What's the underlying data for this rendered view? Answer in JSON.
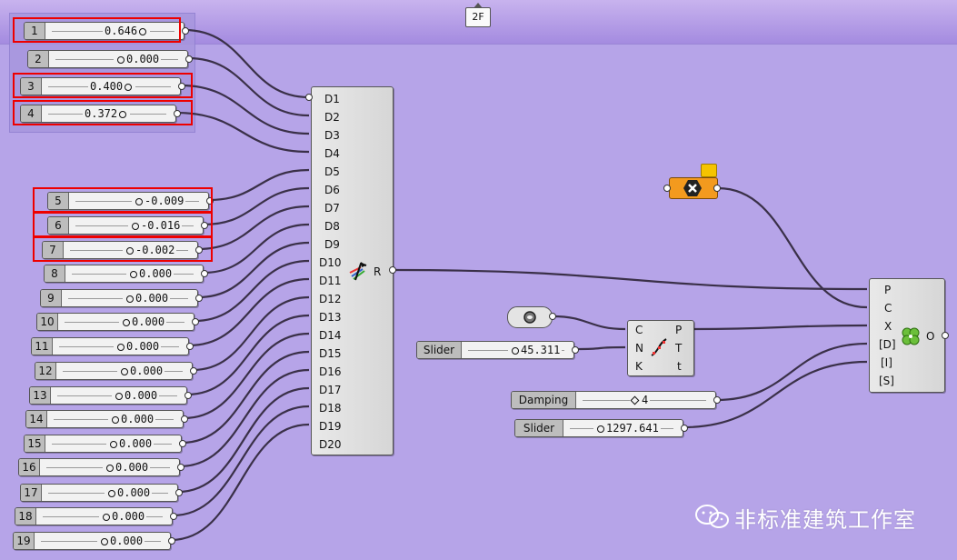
{
  "group": {
    "tab_label": "2F"
  },
  "number_sliders": [
    {
      "name": "1",
      "value": "0.646"
    },
    {
      "name": "2",
      "value": "0.000"
    },
    {
      "name": "3",
      "value": "0.400"
    },
    {
      "name": "4",
      "value": "0.372"
    },
    {
      "name": "5",
      "value": "-0.009"
    },
    {
      "name": "6",
      "value": "-0.016"
    },
    {
      "name": "7",
      "value": "-0.002"
    },
    {
      "name": "8",
      "value": "0.000"
    },
    {
      "name": "9",
      "value": "0.000"
    },
    {
      "name": "10",
      "value": "0.000"
    },
    {
      "name": "11",
      "value": "0.000"
    },
    {
      "name": "12",
      "value": "0.000"
    },
    {
      "name": "13",
      "value": "0.000"
    },
    {
      "name": "14",
      "value": "0.000"
    },
    {
      "name": "15",
      "value": "0.000"
    },
    {
      "name": "16",
      "value": "0.000"
    },
    {
      "name": "17",
      "value": "0.000"
    },
    {
      "name": "18",
      "value": "0.000"
    },
    {
      "name": "19",
      "value": "0.000"
    }
  ],
  "data_component": {
    "inputs": [
      "D1",
      "D2",
      "D3",
      "D4",
      "D5",
      "D6",
      "D7",
      "D8",
      "D9",
      "D10",
      "D11",
      "D12",
      "D13",
      "D14",
      "D15",
      "D16",
      "D17",
      "D18",
      "D19",
      "D20"
    ],
    "output": "R",
    "icon": "arrows-icon"
  },
  "curve_component": {
    "inputs": [
      "C",
      "N",
      "K"
    ],
    "outputs": [
      "P",
      "T",
      "t"
    ],
    "icon": "curve-points-icon"
  },
  "solver_component": {
    "inputs": [
      "P",
      "C",
      "X",
      "[D]",
      "[I]",
      "[S]"
    ],
    "output": "O",
    "icon": "clover-icon"
  },
  "slider_45": {
    "name": "Slider",
    "value": "45.311"
  },
  "damping": {
    "name": "Damping",
    "value": "4"
  },
  "slider_1297": {
    "name": "Slider",
    "value": "1297.641"
  },
  "watermark": {
    "text": "非标准建筑工作室"
  }
}
